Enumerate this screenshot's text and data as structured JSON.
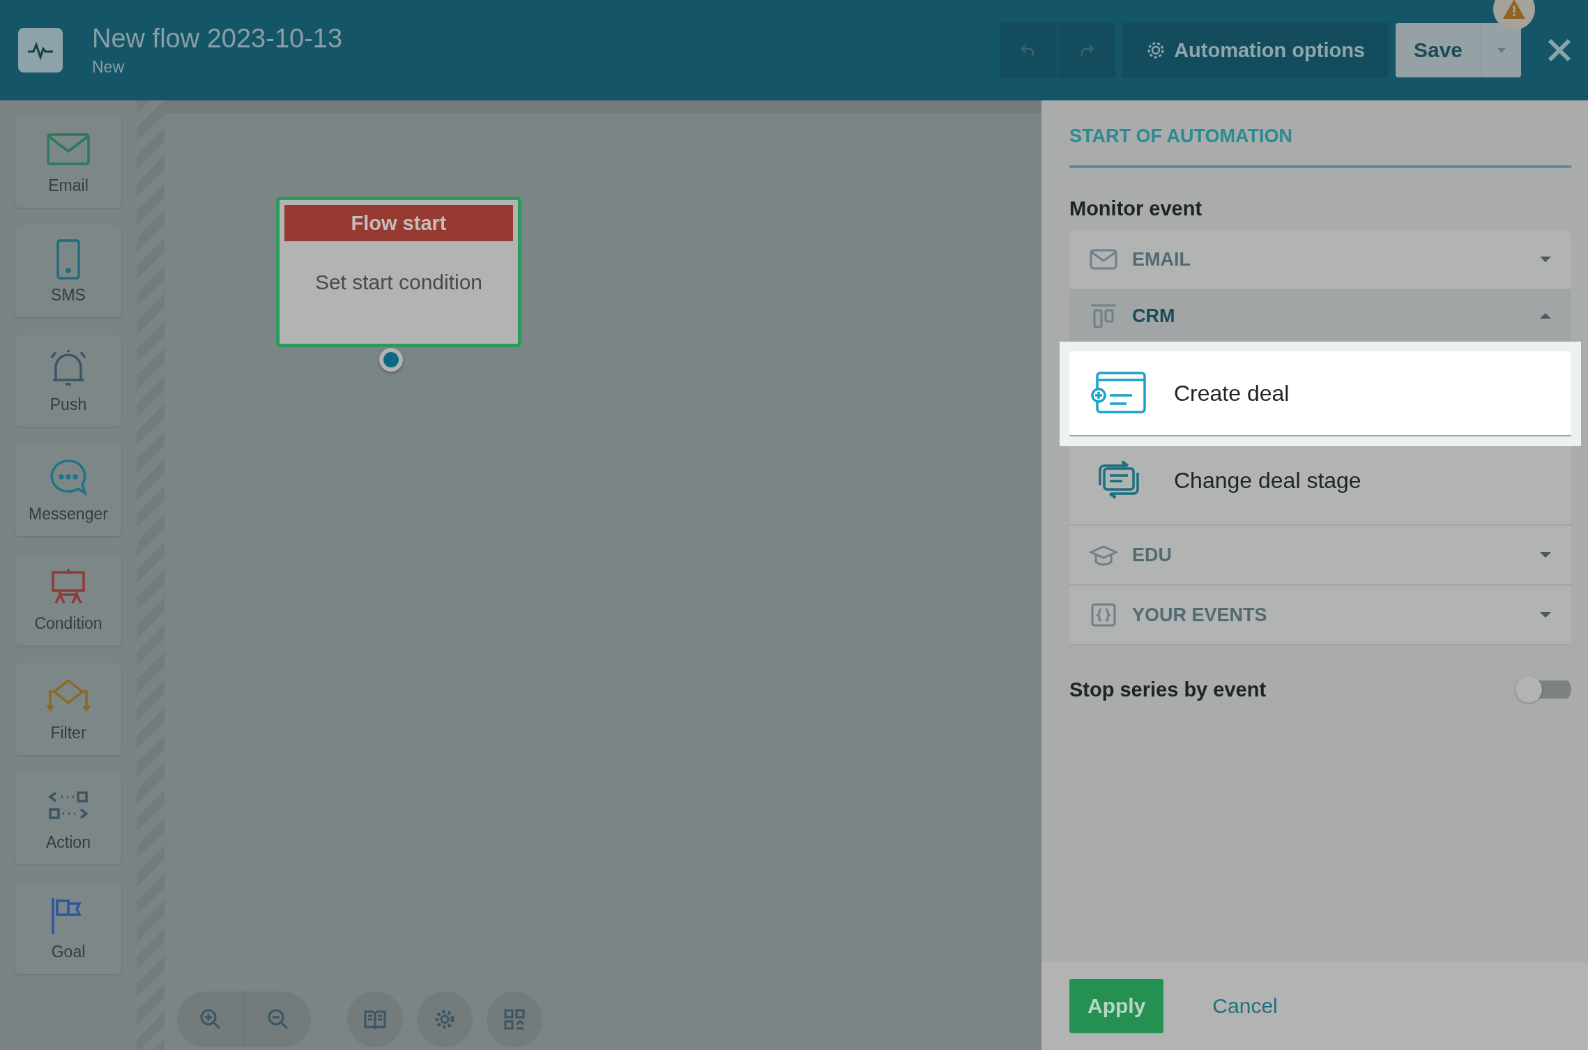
{
  "header": {
    "title": "New flow 2023-10-13",
    "subtitle": "New",
    "options_button": "Automation options",
    "save_button": "Save",
    "warning": true
  },
  "palette": [
    {
      "label": "Email",
      "kind": "email"
    },
    {
      "label": "SMS",
      "kind": "sms"
    },
    {
      "label": "Push",
      "kind": "push"
    },
    {
      "label": "Messenger",
      "kind": "messenger"
    },
    {
      "label": "Condition",
      "kind": "condition"
    },
    {
      "label": "Filter",
      "kind": "filter"
    },
    {
      "label": "Action",
      "kind": "action"
    },
    {
      "label": "Goal",
      "kind": "goal"
    }
  ],
  "canvas": {
    "node": {
      "title": "Flow start",
      "body": "Set start condition"
    },
    "toolbar": [
      {
        "kind": "zoom-in"
      },
      {
        "kind": "zoom-out"
      },
      {
        "kind": "book"
      },
      {
        "kind": "settings"
      },
      {
        "kind": "grid"
      }
    ]
  },
  "panel": {
    "heading": "START OF AUTOMATION",
    "section_label": "Monitor event",
    "groups": [
      {
        "label": "EMAIL",
        "kind": "email",
        "expanded": false
      },
      {
        "label": "CRM",
        "kind": "crm",
        "expanded": true,
        "items": [
          {
            "label": "Create deal",
            "kind": "create",
            "selected": true
          },
          {
            "label": "Change deal stage",
            "kind": "change",
            "selected": false
          }
        ]
      },
      {
        "label": "EDU",
        "kind": "edu",
        "expanded": false
      },
      {
        "label": "YOUR EVENTS",
        "kind": "events",
        "expanded": false
      }
    ],
    "toggle": {
      "label": "Stop series by event",
      "on": false
    },
    "apply": "Apply",
    "cancel": "Cancel"
  }
}
